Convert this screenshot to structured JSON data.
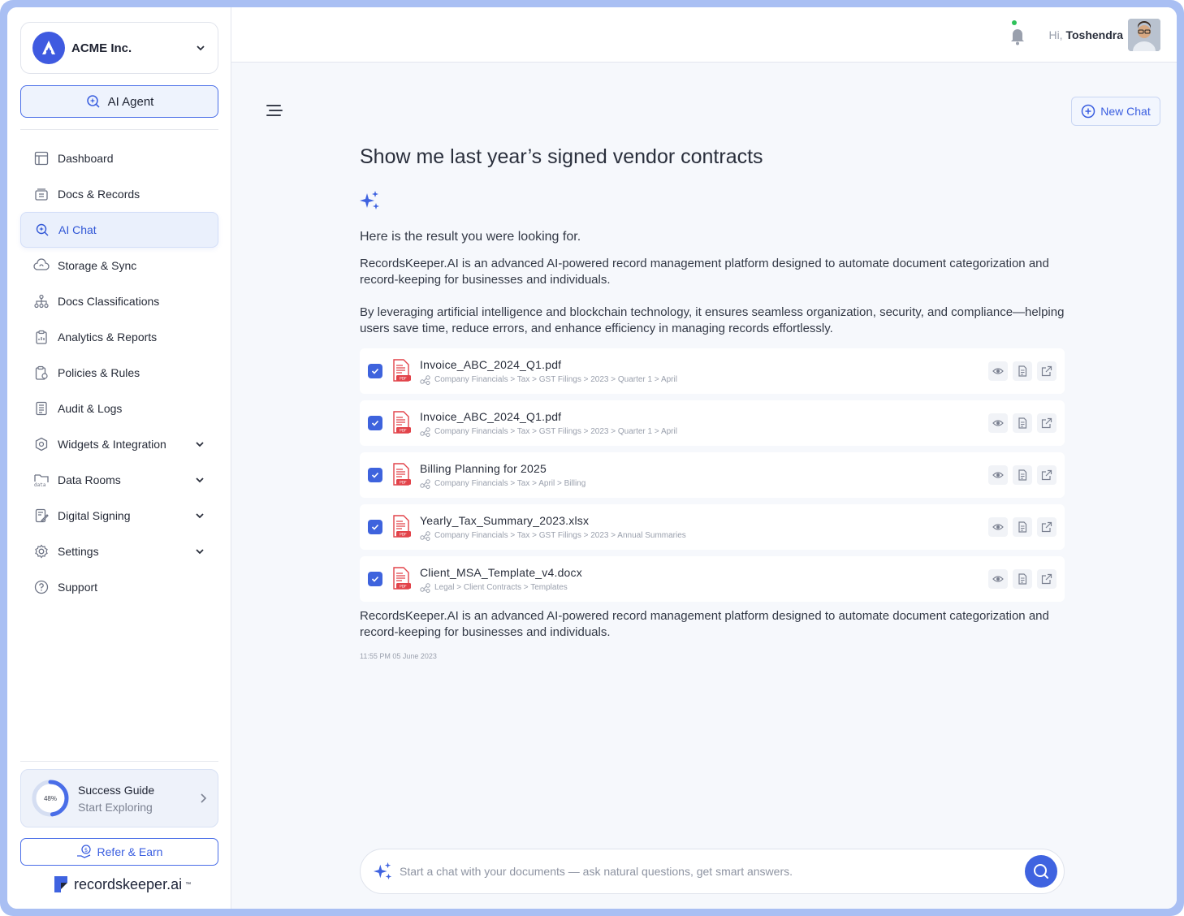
{
  "org": {
    "name": "ACME Inc.",
    "logo_letter": "A"
  },
  "agent_button": {
    "label": "AI Agent"
  },
  "sidebar": {
    "items": [
      {
        "label": "Dashboard",
        "icon": "dashboard-icon",
        "expandable": false,
        "active": false
      },
      {
        "label": "Docs & Records",
        "icon": "docs-icon",
        "expandable": false,
        "active": false
      },
      {
        "label": "AI Chat",
        "icon": "ai-chat-icon",
        "expandable": false,
        "active": true
      },
      {
        "label": "Storage & Sync",
        "icon": "cloud-sync-icon",
        "expandable": false,
        "active": false
      },
      {
        "label": "Docs Classifications",
        "icon": "hierarchy-icon",
        "expandable": false,
        "active": false
      },
      {
        "label": "Analytics & Reports",
        "icon": "clipboard-icon",
        "expandable": false,
        "active": false
      },
      {
        "label": "Policies & Rules",
        "icon": "policy-icon",
        "expandable": false,
        "active": false
      },
      {
        "label": "Audit & Logs",
        "icon": "list-icon",
        "expandable": false,
        "active": false
      },
      {
        "label": "Widgets & Integration",
        "icon": "widgets-icon",
        "expandable": true,
        "active": false
      },
      {
        "label": "Data Rooms",
        "icon": "folder-data-icon",
        "expandable": true,
        "active": false
      },
      {
        "label": "Digital Signing",
        "icon": "signing-icon",
        "expandable": true,
        "active": false
      },
      {
        "label": "Settings",
        "icon": "gear-icon",
        "expandable": true,
        "active": false
      },
      {
        "label": "Support",
        "icon": "help-icon",
        "expandable": false,
        "active": false
      }
    ]
  },
  "guide": {
    "title": "Success Guide",
    "subtitle": "Start Exploring",
    "progress_label": "48%",
    "progress": 0.48
  },
  "refer": {
    "label": "Refer & Earn"
  },
  "brand": {
    "name": "recordskeeper.ai",
    "tm": "™"
  },
  "header": {
    "greeting": "Hi,",
    "user": "Toshendra",
    "notification": true
  },
  "new_chat": {
    "label": "New Chat"
  },
  "chat": {
    "question": "Show me last year’s signed vendor contracts",
    "lead": "Here is the result you were looking for.",
    "para1": "RecordsKeeper.AI is an advanced AI-powered record management platform designed to automate document categorization and record-keeping for businesses and individuals.",
    "para2": "By leveraging artificial intelligence and blockchain technology, it ensures seamless organization, security, and compliance—helping users save time, reduce errors, and enhance efficiency in managing records effortlessly.",
    "files": [
      {
        "name": "Invoice_ABC_2024_Q1.pdf",
        "path": "Company Financials > Tax > GST Filings > 2023 > Quarter 1 > April",
        "checked": true
      },
      {
        "name": "Invoice_ABC_2024_Q1.pdf",
        "path": "Company Financials > Tax > GST Filings > 2023 > Quarter 1 > April",
        "checked": true
      },
      {
        "name": "Billing Planning for 2025",
        "path": "Company Financials > Tax > April > Billing",
        "checked": true
      },
      {
        "name": "Yearly_Tax_Summary_2023.xlsx",
        "path": "Company Financials > Tax > GST Filings > 2023 > Annual Summaries",
        "checked": true
      },
      {
        "name": "Client_MSA_Template_v4.docx",
        "path": "Legal > Client Contracts > Templates",
        "checked": true
      }
    ],
    "para3": "RecordsKeeper.AI is an advanced AI-powered record management platform designed to automate document categorization and record-keeping for businesses and individuals.",
    "timestamp": "11:55 PM 05 June 2023"
  },
  "input": {
    "placeholder": "Start a chat with your documents — ask natural questions, get smart answers.",
    "value": ""
  },
  "colors": {
    "accent": "#3f63e0",
    "frame": "#a9bff3",
    "active_bg": "#eaf0fc"
  }
}
